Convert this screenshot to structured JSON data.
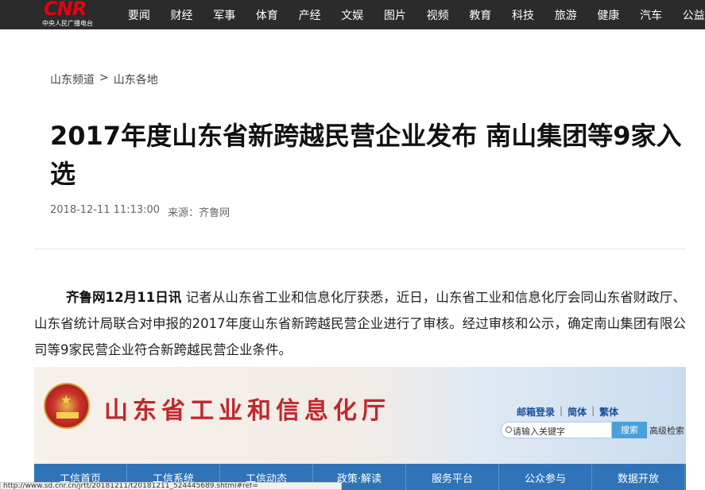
{
  "site": {
    "logo_text": "CNR",
    "logo_sub": "中央人民广播电台",
    "nav": [
      "要闻",
      "财经",
      "军事",
      "体育",
      "产经",
      "文娱",
      "图片",
      "视频",
      "教育",
      "科技",
      "旅游",
      "健康",
      "汽车",
      "公益"
    ]
  },
  "breadcrumb": {
    "items": [
      "山东频道",
      "山东各地"
    ],
    "separator": ">"
  },
  "article": {
    "title": "2017年度山东省新跨越民营企业发布 南山集团等9家入选",
    "datetime": "2018-12-11 11:13:00",
    "source": "来源：齐鲁网",
    "lead": "齐鲁网12月11日讯",
    "body": " 记者从山东省工业和信息化厅获悉，近日，山东省工业和信息化厅会同山东省财政厅、山东省统计局联合对申报的2017年度山东省新跨越民营企业进行了审核。经过审核和公示，确定南山集团有限公司等9家民营企业符合新跨越民营企业条件。"
  },
  "embed": {
    "dept_name": "山东省工业和信息化厅",
    "links": [
      "邮箱登录",
      "简体",
      "繁体"
    ],
    "link_sep": "|",
    "search_placeholder": "请输入关键字",
    "search_button": "搜索",
    "advanced_search": "高级检索",
    "menu": [
      "工信首页",
      "工信系统",
      "工信动态",
      "政策·解读",
      "服务平台",
      "公众参与",
      "数据开放"
    ]
  },
  "status_url": "http://www.sd.cnr.cn/jrtt/20181211/t20181211_524445689.shtml#ref="
}
